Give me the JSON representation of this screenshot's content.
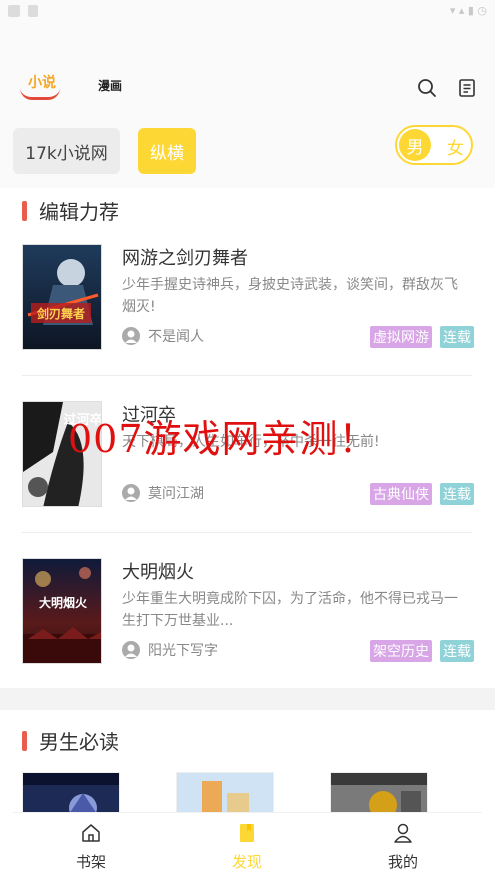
{
  "header": {
    "tab_novel": "小说",
    "tab_comic": "漫画"
  },
  "sources": {
    "items": [
      "17k小说网",
      "纵横"
    ]
  },
  "gender": {
    "male": "男",
    "female": "女"
  },
  "editor_picks": {
    "title": "编辑力荐",
    "books": [
      {
        "title": "网游之剑刃舞者",
        "desc": "少年手握史诗神兵，身披史诗武装，谈笑间，群敌灰飞烟灭!",
        "author": "不是闻人",
        "genre": "虚拟网游",
        "status": "连载",
        "cover_text": "剑刃舞者"
      },
      {
        "title": "过河卒",
        "desc": "天下棋局，人生如车行，卒中杀一往无前!",
        "author": "莫问江湖",
        "genre": "古典仙侠",
        "status": "连载",
        "cover_text": "过河卒"
      },
      {
        "title": "大明烟火",
        "desc": "少年重生大明竟成阶下囚，为了活命，他不得已戎马一生打下万世基业...",
        "author": "阳光下写字",
        "genre": "架空历史",
        "status": "连载",
        "cover_text": "大明烟火"
      }
    ]
  },
  "male_must_read": {
    "title": "男生必读"
  },
  "watermark": "007游戏网亲测！",
  "bottom_nav": {
    "items": [
      "书架",
      "发现",
      "我的"
    ],
    "active_color": "#fdd835"
  },
  "colors": {
    "accent": "#fdd835",
    "section_bar": "#e85d4e",
    "tag_genre": "#d8a5e6",
    "tag_status": "#8fd3d8"
  }
}
